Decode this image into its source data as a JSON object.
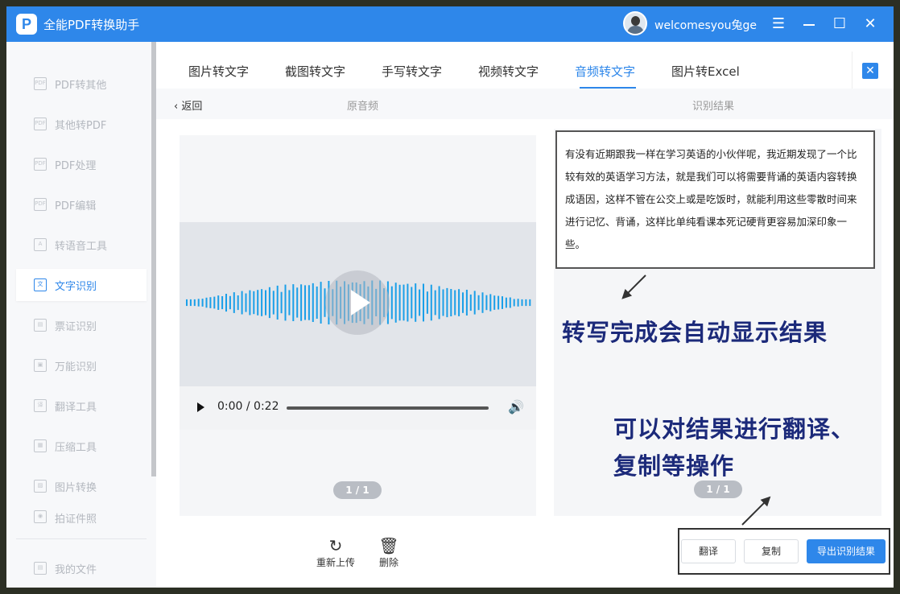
{
  "app": {
    "title": "全能PDF转换助手",
    "logo_letter": "P",
    "username": "welcomesyou兔ge"
  },
  "window_controls": {
    "menu": "☰",
    "maximize": "☐",
    "close": "✕"
  },
  "sidebar": {
    "items": [
      {
        "label": "PDF转其他",
        "icon": "pdf-convert-icon",
        "glyph": "PDF"
      },
      {
        "label": "其他转PDF",
        "icon": "to-pdf-icon",
        "glyph": "PDF"
      },
      {
        "label": "PDF处理",
        "icon": "pdf-process-icon",
        "glyph": "PDF"
      },
      {
        "label": "PDF编辑",
        "icon": "pdf-edit-icon",
        "glyph": "PDF"
      },
      {
        "label": "转语音工具",
        "icon": "speech-icon",
        "glyph": "A"
      },
      {
        "label": "文字识别",
        "icon": "ocr-icon",
        "glyph": "文"
      },
      {
        "label": "票证识别",
        "icon": "ticket-icon",
        "glyph": "▤"
      },
      {
        "label": "万能识别",
        "icon": "universal-icon",
        "glyph": "▣"
      },
      {
        "label": "翻译工具",
        "icon": "translate-icon",
        "glyph": "译"
      },
      {
        "label": "压缩工具",
        "icon": "compress-icon",
        "glyph": "▦"
      },
      {
        "label": "图片转换",
        "icon": "image-icon",
        "glyph": "▨"
      },
      {
        "label": "拍证件照",
        "icon": "photo-id-icon",
        "glyph": "◉"
      }
    ],
    "my_files": "我的文件"
  },
  "tabs": [
    "图片转文字",
    "截图转文字",
    "手写转文字",
    "视频转文字",
    "音频转文字",
    "图片转Excel"
  ],
  "active_tab": "音频转文字",
  "subheader": {
    "back": "返回",
    "original": "原音频",
    "result": "识别结果"
  },
  "audio": {
    "time": "0:00 / 0:22"
  },
  "pager_left": "1 / 1",
  "pager_right": "1 / 1",
  "result_text": "有没有近期跟我一样在学习英语的小伙伴呢，我近期发现了一个比较有效的英语学习方法，就是我们可以将需要背诵的英语内容转换成语因，这样不管在公交上或是吃饭时，就能利用这些零散时间来进行记忆、背诵，这样比单纯看课本死记硬背更容易加深印象一些。",
  "annotations": {
    "auto_display": "转写完成会自动显示结果",
    "translate_copy_line1": "可以对结果进行翻译、",
    "translate_copy_line2": "复制等操作"
  },
  "tools": {
    "reupload": "重新上传",
    "delete": "删除"
  },
  "actions": {
    "translate": "翻译",
    "copy": "复制",
    "export": "导出识别结果"
  },
  "colors": {
    "accent": "#2e87ea",
    "annotation": "#1c2a7a",
    "waveform": "#1a9fe8"
  }
}
